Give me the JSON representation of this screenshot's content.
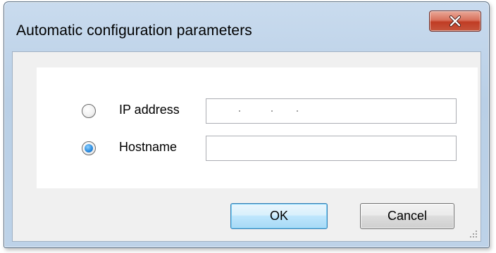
{
  "dialog": {
    "title": "Automatic configuration parameters",
    "close_icon": "close-x-icon"
  },
  "options": [
    {
      "label": "IP address",
      "checked": false,
      "value": ""
    },
    {
      "label": "Hostname",
      "checked": true,
      "value": ""
    }
  ],
  "buttons": {
    "ok_label": "OK",
    "cancel_label": "Cancel"
  },
  "colors": {
    "title_bar": "#bdd2e8",
    "close_button": "#c03c24",
    "radio_selected": "#2f8ee0",
    "ok_button_border": "#3c7fb1"
  }
}
